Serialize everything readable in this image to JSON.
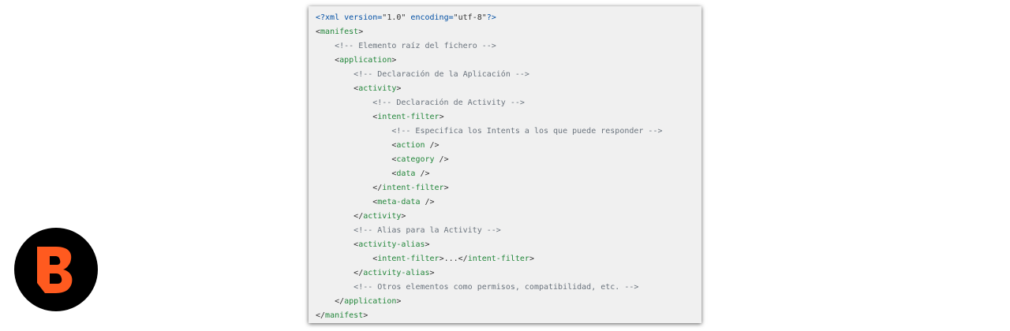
{
  "logo": {
    "letter": "B",
    "fill": "#ff5a1f",
    "background": "#000000"
  },
  "colors": {
    "tag": "#22863a",
    "comment": "#6a737d",
    "decl": "#0451a5",
    "text": "#333333"
  },
  "code": {
    "indent_unit": 4,
    "lines": [
      {
        "indent": 0,
        "tokens": [
          {
            "t": "<?xml version=",
            "c": "decl"
          },
          {
            "t": "\"1.0\"",
            "c": "text"
          },
          {
            "t": " encoding=",
            "c": "decl"
          },
          {
            "t": "\"utf-8\"",
            "c": "text"
          },
          {
            "t": "?>",
            "c": "decl"
          }
        ]
      },
      {
        "indent": 0,
        "tokens": [
          {
            "t": "<",
            "c": "text"
          },
          {
            "t": "manifest",
            "c": "tag"
          },
          {
            "t": ">",
            "c": "text"
          }
        ]
      },
      {
        "indent": 1,
        "tokens": [
          {
            "t": "<!-- Elemento raíz del fichero -->",
            "c": "comment"
          }
        ]
      },
      {
        "indent": 1,
        "tokens": [
          {
            "t": "<",
            "c": "text"
          },
          {
            "t": "application",
            "c": "tag"
          },
          {
            "t": ">",
            "c": "text"
          }
        ]
      },
      {
        "indent": 2,
        "tokens": [
          {
            "t": "<!-- Declaración de la Aplicación -->",
            "c": "comment"
          }
        ]
      },
      {
        "indent": 2,
        "tokens": [
          {
            "t": "<",
            "c": "text"
          },
          {
            "t": "activity",
            "c": "tag"
          },
          {
            "t": ">",
            "c": "text"
          }
        ]
      },
      {
        "indent": 3,
        "tokens": [
          {
            "t": "<!-- Declaración de Activity -->",
            "c": "comment"
          }
        ]
      },
      {
        "indent": 3,
        "tokens": [
          {
            "t": "<",
            "c": "text"
          },
          {
            "t": "intent-filter",
            "c": "tag"
          },
          {
            "t": ">",
            "c": "text"
          }
        ]
      },
      {
        "indent": 4,
        "tokens": [
          {
            "t": "<!-- Especifica los Intents a los que puede responder -->",
            "c": "comment"
          }
        ]
      },
      {
        "indent": 4,
        "tokens": [
          {
            "t": "<",
            "c": "text"
          },
          {
            "t": "action",
            "c": "tag"
          },
          {
            "t": " />",
            "c": "text"
          }
        ]
      },
      {
        "indent": 4,
        "tokens": [
          {
            "t": "<",
            "c": "text"
          },
          {
            "t": "category",
            "c": "tag"
          },
          {
            "t": " />",
            "c": "text"
          }
        ]
      },
      {
        "indent": 4,
        "tokens": [
          {
            "t": "<",
            "c": "text"
          },
          {
            "t": "data",
            "c": "tag"
          },
          {
            "t": " />",
            "c": "text"
          }
        ]
      },
      {
        "indent": 3,
        "tokens": [
          {
            "t": "</",
            "c": "text"
          },
          {
            "t": "intent-filter",
            "c": "tag"
          },
          {
            "t": ">",
            "c": "text"
          }
        ]
      },
      {
        "indent": 3,
        "tokens": [
          {
            "t": "<",
            "c": "text"
          },
          {
            "t": "meta-data",
            "c": "tag"
          },
          {
            "t": " />",
            "c": "text"
          }
        ]
      },
      {
        "indent": 2,
        "tokens": [
          {
            "t": "</",
            "c": "text"
          },
          {
            "t": "activity",
            "c": "tag"
          },
          {
            "t": ">",
            "c": "text"
          }
        ]
      },
      {
        "indent": 2,
        "tokens": [
          {
            "t": "<!-- Alias para la Activity -->",
            "c": "comment"
          }
        ]
      },
      {
        "indent": 2,
        "tokens": [
          {
            "t": "<",
            "c": "text"
          },
          {
            "t": "activity-alias",
            "c": "tag"
          },
          {
            "t": ">",
            "c": "text"
          }
        ]
      },
      {
        "indent": 3,
        "tokens": [
          {
            "t": "<",
            "c": "text"
          },
          {
            "t": "intent-filter",
            "c": "tag"
          },
          {
            "t": ">...</",
            "c": "text"
          },
          {
            "t": "intent-filter",
            "c": "tag"
          },
          {
            "t": ">",
            "c": "text"
          }
        ]
      },
      {
        "indent": 2,
        "tokens": [
          {
            "t": "</",
            "c": "text"
          },
          {
            "t": "activity-alias",
            "c": "tag"
          },
          {
            "t": ">",
            "c": "text"
          }
        ]
      },
      {
        "indent": 2,
        "tokens": [
          {
            "t": "<!-- Otros elementos como permisos, compatibilidad, etc. -->",
            "c": "comment"
          }
        ]
      },
      {
        "indent": 1,
        "tokens": [
          {
            "t": "</",
            "c": "text"
          },
          {
            "t": "application",
            "c": "tag"
          },
          {
            "t": ">",
            "c": "text"
          }
        ]
      },
      {
        "indent": 0,
        "tokens": [
          {
            "t": "</",
            "c": "text"
          },
          {
            "t": "manifest",
            "c": "tag"
          },
          {
            "t": ">",
            "c": "text"
          }
        ]
      }
    ]
  }
}
